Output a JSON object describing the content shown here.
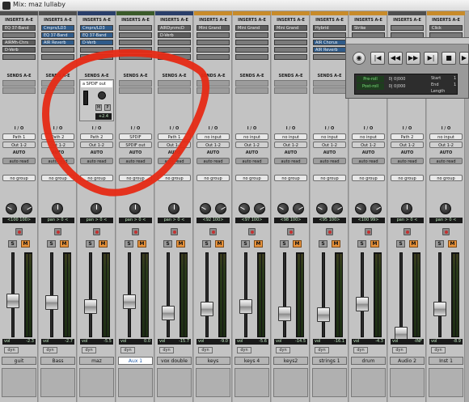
{
  "window": {
    "title": "Mix: maz lullaby"
  },
  "labels": {
    "inserts": "INSERTS A-E",
    "sends": "SENDS A-E",
    "io": "I / O",
    "auto": "AUTO"
  },
  "strips": [
    {
      "name": "guit",
      "color": "#4f4f4f",
      "inserts": [
        "EQ 37-Band",
        "",
        "AIRMh-Chrs",
        "D-Verb"
      ],
      "input": "Path 1",
      "output": "Out 1-2",
      "auto": "auto read",
      "group": "no group",
      "pan": [
        "<100",
        "100>"
      ],
      "vol": "-2.3",
      "fader": 0.55
    },
    {
      "name": "Bass",
      "color": "#4f4f4f",
      "inserts": [
        "Cmprs/LD3",
        "EQ 37-Band",
        "AIR Reverb",
        ""
      ],
      "input": "Path 2",
      "output": "Out 1-2",
      "auto": "auto read",
      "group": "no group",
      "pan": [
        "pan",
        "> 0 <"
      ],
      "vol": "-2.7",
      "fader": 0.58
    },
    {
      "name": "maz",
      "color": "#2a3f6a",
      "inserts": [
        "Cmprs/LD3",
        "EQ 37-Band",
        "D-Verb",
        ""
      ],
      "input": "Path 2",
      "output": "Out 1-2",
      "auto": "auto read",
      "group": "no group",
      "pan": [
        "pan",
        "> 0 <"
      ],
      "vol": "-5.5",
      "fader": 0.63
    },
    {
      "name": "Aux 1",
      "color": "#3a5a2a",
      "inserts": [
        "",
        "",
        "",
        ""
      ],
      "input": "SPDIF",
      "output": "SPDIF out",
      "auto": "auto read",
      "group": "no group",
      "pan": [
        "pan",
        "> 0 <"
      ],
      "vol": "0.0",
      "fader": 0.57,
      "selected": true
    },
    {
      "name": "vox double",
      "color": "#2a3f6a",
      "inserts": [
        "AIRDynmcD",
        "D-Verb",
        "",
        ""
      ],
      "input": "Path 1",
      "output": "Out 1-2",
      "auto": "auto read",
      "group": "no group",
      "pan": [
        "pan",
        "> 0 <"
      ],
      "vol": "-15.7",
      "fader": 0.72
    },
    {
      "name": "keys",
      "color": "#c88b2a",
      "inserts": [
        "Mini Grand",
        "",
        "",
        ""
      ],
      "input": "no input",
      "output": "Out 1-2",
      "auto": "auto read",
      "group": "no group",
      "pan": [
        "<92",
        "100>"
      ],
      "vol": "-9.0",
      "fader": 0.66
    },
    {
      "name": "keys 4",
      "color": "#c88b2a",
      "inserts": [
        "Mini Grand",
        "",
        "",
        ""
      ],
      "input": "no input",
      "output": "Out 1-2",
      "auto": "auto read",
      "group": "no group",
      "pan": [
        "<97",
        "100>"
      ],
      "vol": "-5.6",
      "fader": 0.63
    },
    {
      "name": "keys2",
      "color": "#c88b2a",
      "inserts": [
        "Mini Grand",
        "",
        "",
        ""
      ],
      "input": "no input",
      "output": "Out 1-2",
      "auto": "auto read",
      "group": "no group",
      "pan": [
        "<98",
        "100>"
      ],
      "vol": "-14.5",
      "fader": 0.73
    },
    {
      "name": "strings 1",
      "color": "#c88b2a",
      "inserts": [
        "Hybrid",
        "",
        "AIR Chorus",
        "AIR Reverb"
      ],
      "input": "no input",
      "output": "Out 1-2",
      "auto": "auto read",
      "group": "no group",
      "pan": [
        "<95",
        "100>"
      ],
      "vol": "-16.1",
      "fader": 0.74
    },
    {
      "name": "drum",
      "color": "#c88b2a",
      "inserts": [
        "Strike",
        "",
        "",
        ""
      ],
      "input": "no input",
      "output": "Out 1-2",
      "auto": "auto read",
      "group": "no group",
      "pan": [
        "<100",
        "99>"
      ],
      "vol": "-4.3",
      "fader": 0.6
    },
    {
      "name": "Audio 2",
      "color": "#4f4f4f",
      "inserts": [
        "",
        "",
        "",
        ""
      ],
      "input": "Path 2",
      "output": "Out 1-2",
      "auto": "auto read",
      "group": "no group",
      "pan": [
        "pan",
        "> 0 <"
      ],
      "vol": "-INF",
      "fader": 1.0
    },
    {
      "name": "Inst 1",
      "color": "#c88b2a",
      "inserts": [
        "Click",
        "",
        "",
        ""
      ],
      "input": "no input",
      "output": "Out 1-2",
      "auto": "auto read",
      "group": "no group",
      "pan": [
        "pan",
        "> 0 <"
      ],
      "vol": "-8.9",
      "fader": 0.66
    }
  ],
  "send_popup": {
    "slot": "a",
    "name": "SPDIF out",
    "mute": "M",
    "pre": "P",
    "level": "+2.4"
  },
  "transport": {
    "buttons": [
      "◀◀",
      "◀◀",
      "▶▶",
      "▶▶",
      "■",
      "▶"
    ],
    "preroll_label": "Pre-roll",
    "postroll_label": "Post-roll",
    "preroll_value": "0| 0|000",
    "postroll_value": "0| 0|000",
    "start_label": "Start",
    "end_label": "End",
    "length_label": "Length",
    "start_value": "1",
    "end_value": "1"
  },
  "strip_label_vol": "vol",
  "strip_label_dyn": "dyn",
  "solo_label": "S",
  "mute_label": "M",
  "accents": {
    "annotation": "#e62a15",
    "meter_green": "#2d6b2d"
  }
}
